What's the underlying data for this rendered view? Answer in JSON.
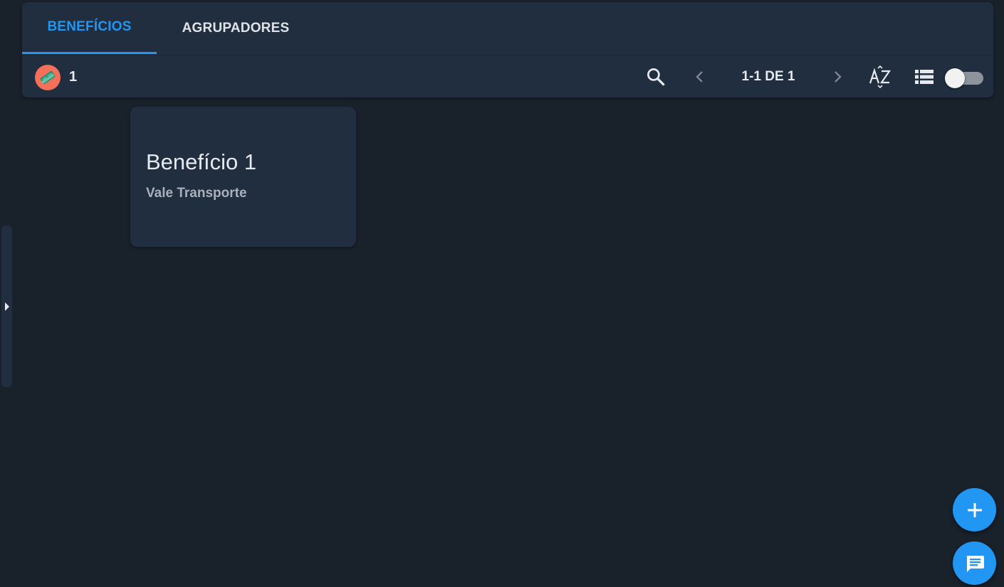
{
  "tabs": [
    {
      "label": "BENEFÍCIOS",
      "active": true
    },
    {
      "label": "AGRUPADORES",
      "active": false
    }
  ],
  "toolbar": {
    "count": "1",
    "pagination": "1-1 DE 1",
    "icons": [
      "search-icon",
      "chevron-left-icon",
      "chevron-right-icon",
      "sort-az-icon",
      "list-view-icon"
    ],
    "toggle_on": false
  },
  "cards": [
    {
      "title": "Benefício 1",
      "subtitle": "Vale Transporte"
    }
  ],
  "colors": {
    "background": "#19212b",
    "surface": "#202e40",
    "accent": "#2196f3",
    "avatar": "#f4705a"
  }
}
